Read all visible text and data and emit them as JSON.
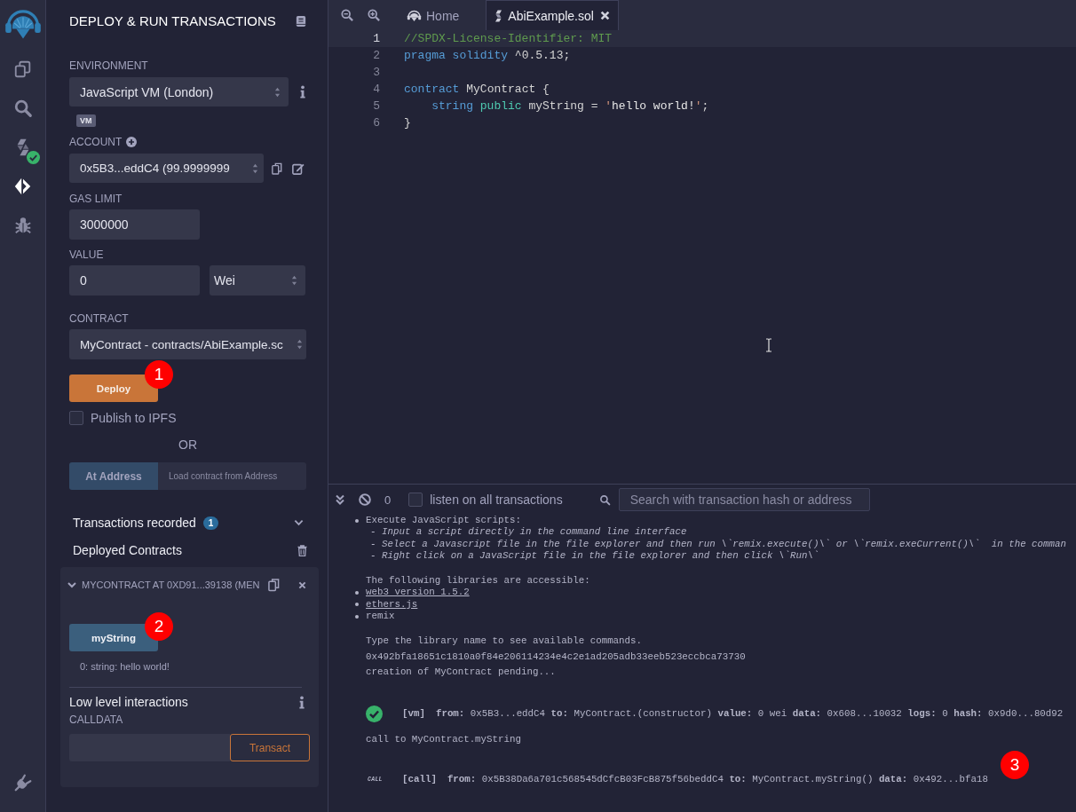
{
  "icon_bar": {
    "items": [
      {
        "kind": "files",
        "selected": false,
        "badge_ok": false
      },
      {
        "kind": "search",
        "selected": false,
        "badge_ok": false
      },
      {
        "kind": "compiler",
        "selected": false,
        "badge_ok": true
      },
      {
        "kind": "deploy",
        "selected": true,
        "badge_ok": false
      },
      {
        "kind": "debugger",
        "selected": false,
        "badge_ok": false
      }
    ]
  },
  "panel": {
    "title": "DEPLOY & RUN TRANSACTIONS",
    "environment": {
      "label": "ENVIRONMENT",
      "value": "JavaScript VM (London)",
      "badge": "VM"
    },
    "account": {
      "label": "ACCOUNT",
      "value": "0x5B3...eddC4 (99.9999999"
    },
    "gas_limit": {
      "label": "GAS LIMIT",
      "value": "3000000"
    },
    "value": {
      "label": "VALUE",
      "amount": "0",
      "unit": "Wei"
    },
    "contract": {
      "label": "CONTRACT",
      "value": "MyContract - contracts/AbiExample.sc"
    },
    "deploy_button": {
      "label": "Deploy",
      "annotation": "1"
    },
    "publish": {
      "label": "Publish to IPFS",
      "checked": false
    },
    "or": "OR",
    "at_address": {
      "button": "At Address",
      "placeholder": "Load contract from Address"
    },
    "transactions_recorded": {
      "label": "Transactions recorded",
      "count": "1",
      "expanded": false
    },
    "deployed_contracts": {
      "label": "Deployed Contracts",
      "instances": [
        {
          "title": "MYCONTRACT AT 0XD91...39138 (MEN",
          "expanded": true,
          "functions": [
            {
              "label": "myString",
              "result": "0: string: hello world!",
              "annotation": "2"
            }
          ],
          "low_level": {
            "title": "Low level interactions",
            "calldata_label": "CALLDATA",
            "button": "Transact"
          }
        }
      ]
    }
  },
  "editor": {
    "tabs": [
      {
        "kind": "home",
        "label": "Home",
        "selected": false
      },
      {
        "kind": "file",
        "label": "AbiExample.sol",
        "selected": true
      }
    ],
    "lines": [
      {
        "number": "1",
        "active": true,
        "tokens": [
          {
            "kind": "comment",
            "text": "//SPDX-License-Identifier: MIT"
          }
        ]
      },
      {
        "number": "2",
        "active": false,
        "tokens": [
          {
            "kind": "keyword",
            "text": "pragma solidity"
          },
          {
            "kind": "plain",
            "text": " ^0.5.13;"
          }
        ]
      },
      {
        "number": "3",
        "active": false
      },
      {
        "number": "4",
        "active": false,
        "tokens": [
          {
            "kind": "keyword",
            "text": "contract"
          },
          {
            "kind": "plain",
            "text": " MyContract {"
          }
        ]
      },
      {
        "number": "5",
        "active": false,
        "tokens": [
          {
            "kind": "keyword",
            "text": "    string"
          },
          {
            "kind": "modifier",
            "text": " public"
          },
          {
            "kind": "plain",
            "text": " myString = "
          },
          {
            "kind": "quote",
            "text": "'"
          },
          {
            "kind": "string",
            "text": "hello world!"
          },
          {
            "kind": "quote",
            "text": "'"
          },
          {
            "kind": "plain",
            "text": ";"
          }
        ]
      },
      {
        "number": "6",
        "active": false,
        "tokens": [
          {
            "kind": "plain",
            "text": "}"
          }
        ]
      }
    ]
  },
  "terminal": {
    "toolbar": {
      "count": "0",
      "listen": {
        "label": "listen on all transactions",
        "checked": false
      },
      "search": {
        "placeholder": "Search with transaction hash or address"
      }
    },
    "help": {
      "title": "Execute JavaScript scripts:",
      "hints": [
        "- Input a script directly in the command line interface",
        "- Select a Javascript file in the file explorer and then run \\`remix.execute()\\` or \\`remix.exeCurrent()\\`  in the comman",
        "- Right click on a JavaScript file in the file explorer and then click \\`Run\\`"
      ]
    },
    "libraries": {
      "intro": "The following libraries are accessible:",
      "items": [
        {
          "text": "web3 version 1.5.2",
          "link": true
        },
        {
          "text": "ethers.js",
          "link": true
        },
        {
          "text": "remix",
          "link": false
        }
      ]
    },
    "type_hint": "Type the library name to see available commands.",
    "log": [
      {
        "kind": "text",
        "text": "0x492bfa18651c1810a0f84e206114234e4c2e1ad205adb33eeb523eccbca73730"
      },
      {
        "kind": "text",
        "text": "creation of MyContract pending..."
      },
      {
        "kind": "tx",
        "tag": "[vm]",
        "text": "**from:** 0x5B3...eddC4 **to:** MyContract.(constructor) **value:** 0 wei **data:** 0x608...10032 **logs:** 0 **hash:** 0x9d0...80d92"
      },
      {
        "kind": "text",
        "text": "call to MyContract.myString"
      },
      {
        "kind": "call",
        "badge": "CALL",
        "tag": "[call]",
        "text": "**from:** 0x5B38Da6a701c568545dCfcB03FcB875f56beddC4 **to:** MyContract.myString() **data:** 0x492...bfa18",
        "annotation": "3"
      }
    ]
  }
}
